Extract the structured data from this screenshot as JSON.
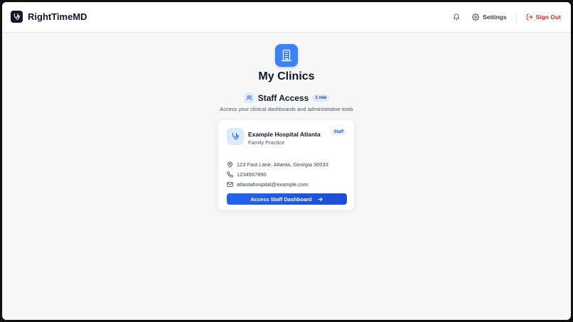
{
  "app": {
    "name": "RightTimeMD"
  },
  "header": {
    "settings_label": "Settings",
    "signout_label": "Sign Out"
  },
  "page": {
    "title": "My Clinics",
    "section_title": "Staff Access",
    "role_count": "1 role",
    "section_subtitle": "Access your clinical dashboards and administrative tools"
  },
  "clinic": {
    "name": "Example Hospital Atlanta",
    "specialty": "Family Practice",
    "badge": "Staff",
    "address": "123 Fast Lane, Atlanta, Georgia 30033",
    "phone": "1234567890",
    "email": "atlantahospital@example.com",
    "cta_label": "Access Staff Dashboard"
  },
  "icons": {
    "logo": "stethoscope-icon",
    "bell": "bell-icon",
    "settings": "gear-icon",
    "signout": "logout-icon",
    "hero": "building-icon",
    "section": "users-icon",
    "clinic": "stethoscope-icon",
    "address": "map-pin-icon",
    "phone": "phone-icon",
    "email": "mail-icon",
    "cta": "arrow-right-icon"
  },
  "colors": {
    "accent": "#2563eb",
    "danger": "#dc2626",
    "brand_dark": "#111827"
  }
}
